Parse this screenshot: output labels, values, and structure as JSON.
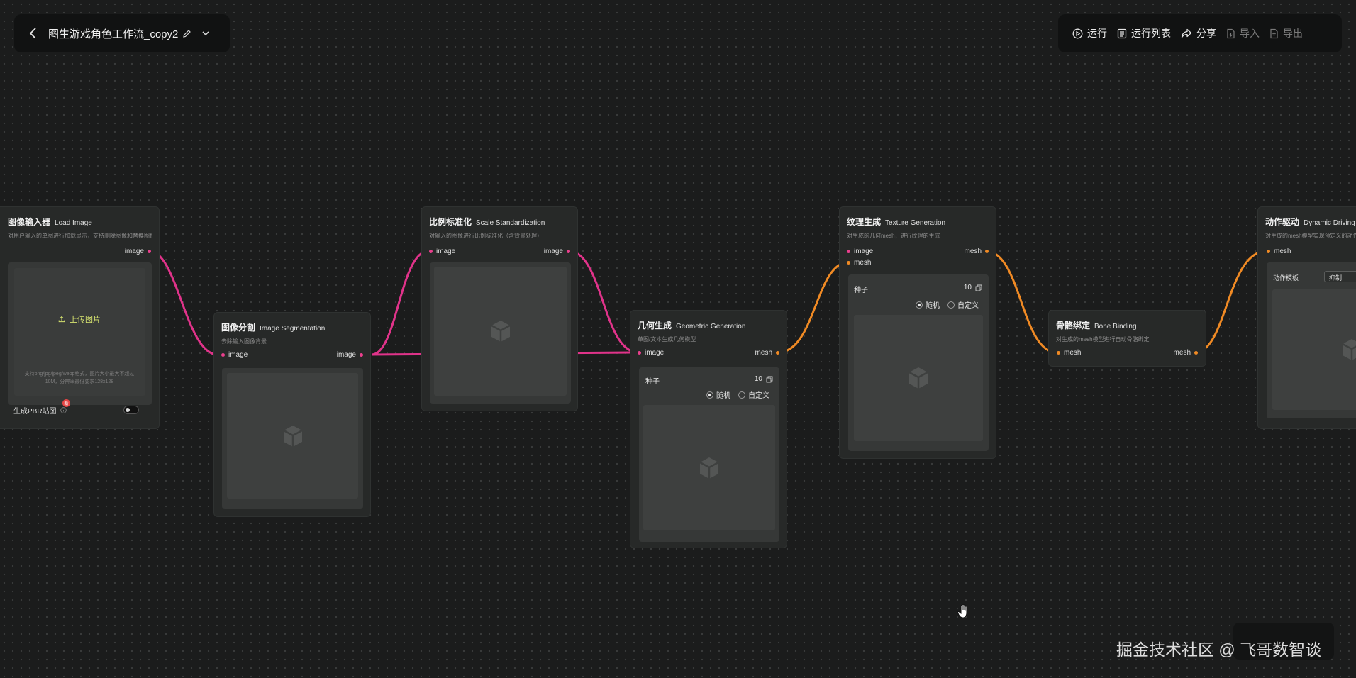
{
  "header": {
    "title": "图生游戏角色工作流_copy2",
    "back_icon": "chevron-left-icon",
    "edit_icon": "pencil-icon",
    "menu_icon": "chevron-down-icon"
  },
  "toolbar": {
    "run": "运行",
    "run_list": "运行列表",
    "share": "分享",
    "import": "导入",
    "export": "导出"
  },
  "colors": {
    "background": "#1b1c1c",
    "node": "#272928",
    "image_wire": "#e0338a",
    "mesh_wire": "#f08a24",
    "upload_text": "#d6e36f"
  },
  "nodes": {
    "load_image": {
      "title_cn": "图像输入器",
      "title_en": "Load Image",
      "desc": "对用户输入的单图进行加载显示，支持删除图像和替换图像",
      "out_port": "image",
      "upload_label": "上传图片",
      "hint": "支持png/jpg/jpeg/webp格式，图片大小最大不超过10M，分辨率最低要求128x128",
      "pbr_label": "生成PBR贴图",
      "badge": "新"
    },
    "segmentation": {
      "title_cn": "图像分割",
      "title_en": "Image Segmentation",
      "desc": "去除输入图像背景",
      "in_port": "image",
      "out_port": "image"
    },
    "scale": {
      "title_cn": "比例标准化",
      "title_en": "Scale Standardization",
      "desc": "对输入的图像进行比例标准化（含背景处理）",
      "in_port": "image",
      "out_port": "image"
    },
    "geometric": {
      "title_cn": "几何生成",
      "title_en": "Geometric Generation",
      "desc": "单图/文本生成几何模型",
      "in_port": "image",
      "out_port": "mesh",
      "seed_label": "种子",
      "seed_value": "10",
      "random_label": "随机",
      "custom_label": "自定义"
    },
    "texture": {
      "title_cn": "纹理生成",
      "title_en": "Texture Generation",
      "desc": "对生成的几何mesh，进行纹理的生成",
      "in_port_1": "image",
      "in_port_2": "mesh",
      "out_port": "mesh",
      "seed_label": "种子",
      "seed_value": "10",
      "random_label": "随机",
      "custom_label": "自定义"
    },
    "bone": {
      "title_cn": "骨骼绑定",
      "title_en": "Bone Binding",
      "desc": "对生成的mesh模型进行自动骨骼绑定",
      "in_port": "mesh",
      "out_port": "mesh"
    },
    "dynamic": {
      "title_cn": "动作驱动",
      "title_en": "Dynamic Driving",
      "desc": "对生成的mesh模型实现预定义的动作驱动",
      "in_port": "mesh",
      "template_label": "动作模板",
      "template_value": "抑制"
    }
  },
  "watermark": "掘金技术社区 @ 飞哥数智谈"
}
